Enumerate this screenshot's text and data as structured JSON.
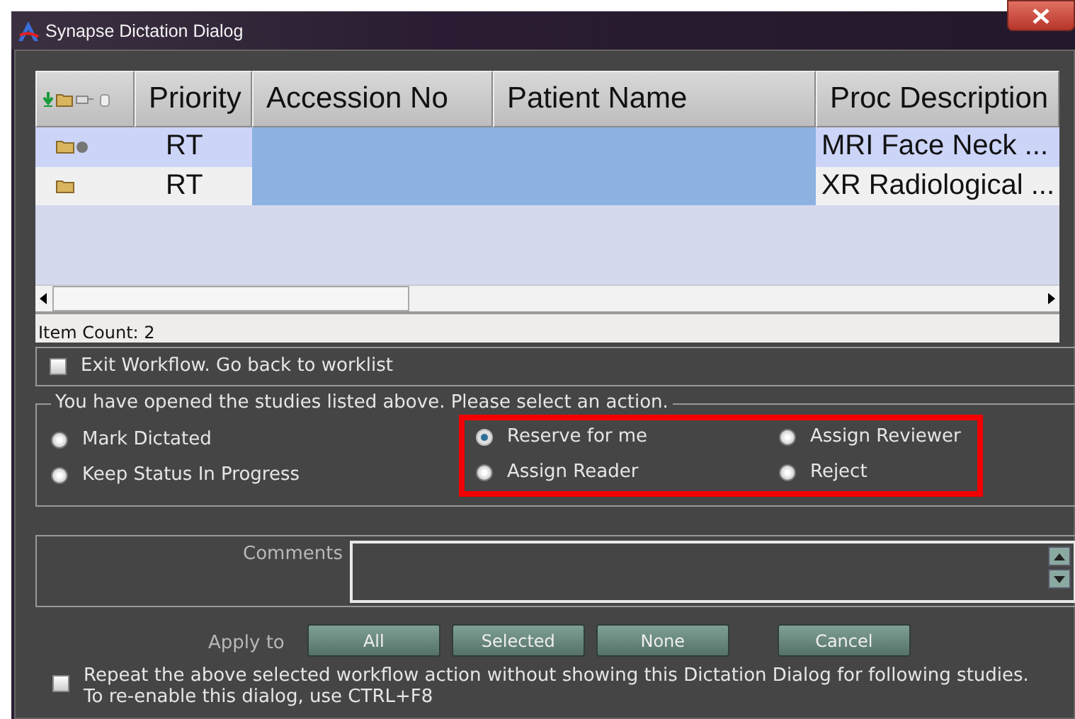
{
  "window": {
    "title": "Synapse Dictation Dialog"
  },
  "table": {
    "columns": [
      "Priority",
      "Accession No",
      "Patient Name",
      "Proc Description"
    ],
    "rows": [
      {
        "kind": "marked",
        "selected": true,
        "priority": "RT",
        "proc_description": "MRI Face Neck ..."
      },
      {
        "kind": "plain",
        "selected": false,
        "priority": "RT",
        "proc_description": "XR Radiological ..."
      }
    ],
    "item_count": "Item Count: 2"
  },
  "exit_workflow": {
    "label": "Exit Workflow. Go back to worklist",
    "checked": false
  },
  "action_group": {
    "legend": "You have opened the studies listed above. Please select an action.",
    "options": [
      {
        "label": "Mark Dictated",
        "selected": false
      },
      {
        "label": "Keep Status In Progress",
        "selected": false
      }
    ],
    "highlighted_options": [
      {
        "label": "Reserve for me",
        "selected": true
      },
      {
        "label": "Assign Reviewer",
        "selected": false
      },
      {
        "label": "Assign Reader",
        "selected": false
      },
      {
        "label": "Reject",
        "selected": false
      }
    ]
  },
  "comments": {
    "label": "Comments"
  },
  "apply_to": {
    "label": "Apply to",
    "buttons": [
      "All",
      "Selected",
      "None"
    ]
  },
  "cancel_button": "Cancel",
  "repeat": {
    "lines": [
      "Repeat the above selected workflow action without showing this Dictation Dialog for following studies.",
      "To re-enable this dialog, use CTRL+F8"
    ],
    "checked": false
  }
}
